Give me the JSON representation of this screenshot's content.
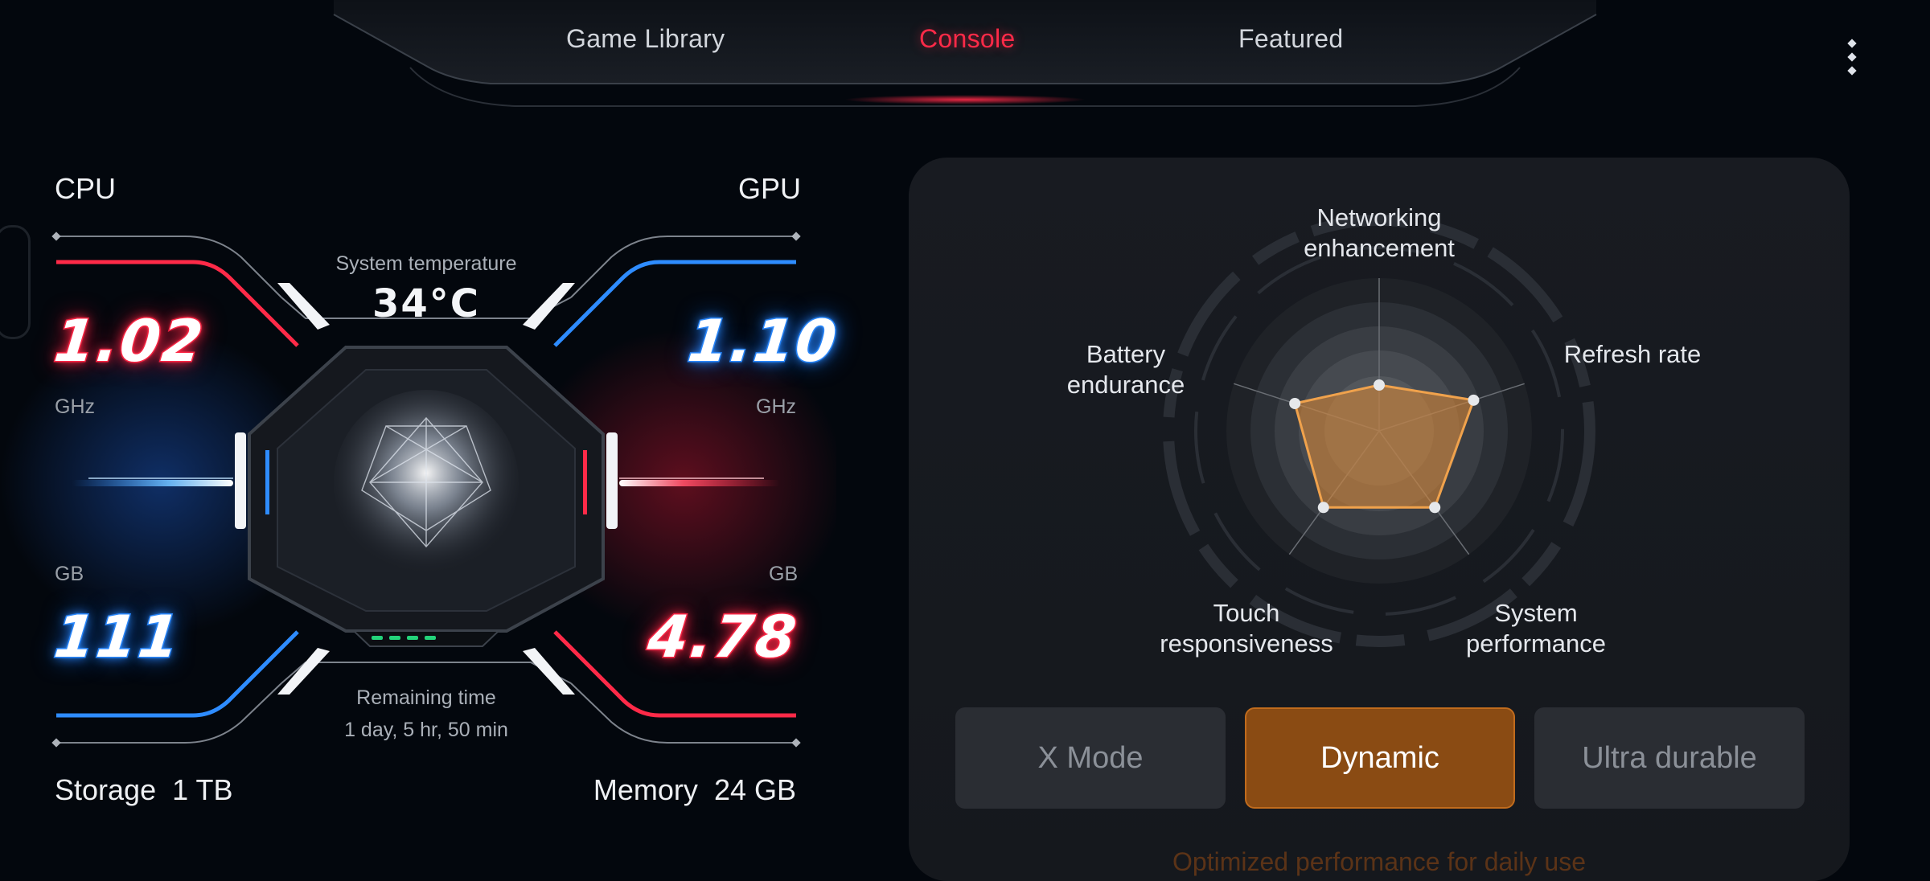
{
  "nav": {
    "tabs": [
      {
        "label": "Game Library",
        "active": false
      },
      {
        "label": "Console",
        "active": true
      },
      {
        "label": "Featured",
        "active": false
      }
    ],
    "more_icon": "more-vertical-icon"
  },
  "dashboard": {
    "cpu": {
      "label": "CPU",
      "value": "1.02",
      "unit": "GHz"
    },
    "gpu": {
      "label": "GPU",
      "value": "1.10",
      "unit": "GHz"
    },
    "storage_left": {
      "value": "111",
      "unit": "GB"
    },
    "memory_left": {
      "value": "4.78",
      "unit": "GB"
    },
    "temperature": {
      "label": "System temperature",
      "value": "34°C"
    },
    "remaining": {
      "label": "Remaining time",
      "value": "1 day, 5 hr, 50 min"
    },
    "storage": {
      "label": "Storage",
      "total": "1 TB"
    },
    "memory": {
      "label": "Memory",
      "total": "24 GB"
    },
    "colors": {
      "red": "#ff2a48",
      "blue": "#2e8cff",
      "battery": "#23d37a"
    }
  },
  "radar": {
    "labels": {
      "networking": "Networking enhancement",
      "refresh": "Refresh rate",
      "system": "System performance",
      "touch": "Touch responsiveness",
      "battery": "Battery endurance"
    },
    "values": {
      "networking": 0.3,
      "refresh": 0.65,
      "system": 0.62,
      "touch": 0.62,
      "battery": 0.58
    },
    "accent": "#f0a24c"
  },
  "modes": {
    "buttons": [
      {
        "label": "X Mode",
        "active": false
      },
      {
        "label": "Dynamic",
        "active": true
      },
      {
        "label": "Ultra durable",
        "active": false
      }
    ],
    "description": "Optimized performance for daily use"
  }
}
